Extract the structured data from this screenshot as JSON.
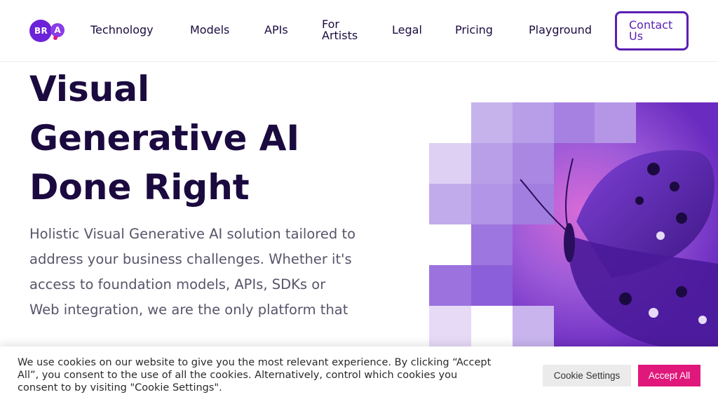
{
  "brand": {
    "logo_main": "BR",
    "logo_accent": "A",
    "colors": {
      "primary": "#5b1fb3",
      "dark": "#1b0a3f",
      "accent": "#e0187b"
    }
  },
  "nav": {
    "technology": "Technology",
    "models": "Models",
    "apis": "APIs",
    "for_artists": "For Artists",
    "legal": "Legal",
    "pricing": "Pricing",
    "playground": "Playground",
    "contact": "Contact Us"
  },
  "hero": {
    "title": "Visual Generative AI Done Right",
    "description": "Holistic Visual Generative AI solution tailored to address your business challenges. Whether it's access to foundation models, APIs, SDKs or Web integration, we are the only platform that",
    "image_icon": "butterfly-mosaic-image"
  },
  "cookie_banner": {
    "text": "We use cookies on our website to give you the most relevant experience. By clicking “Accept All”, you consent to the use of all the cookies. Alternatively, control which cookies you consent to by visiting \"Cookie Settings\".",
    "settings_label": "Cookie Settings",
    "accept_label": "Accept All"
  }
}
